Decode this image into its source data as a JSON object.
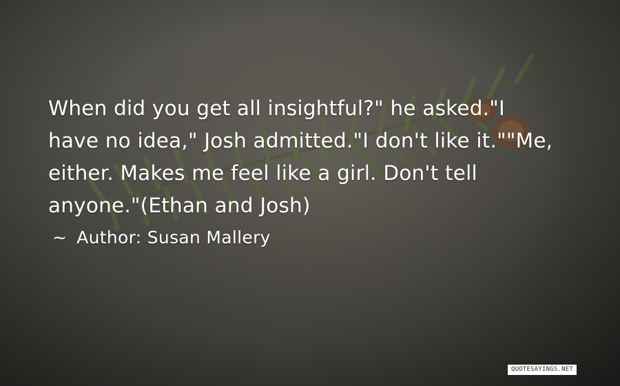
{
  "quote": {
    "lines": [
      "When did you get all insightful?\" he asked.\"I",
      "have no idea,\" Josh admitted.\"I don't like it.\"\"Me,",
      "either. Makes me feel like a girl. Don't tell",
      "anyone.\"(Ethan and Josh)"
    ]
  },
  "attribution": {
    "tilde": "~",
    "label": "Author:",
    "author": "Susan Mallery"
  },
  "watermark": {
    "text": "QUOTESAYINGS.NET"
  },
  "colors": {
    "text": "#ffffff",
    "background": "#4c4a45",
    "branch": "#5f6b3e",
    "cone": "#7a4a2a"
  }
}
